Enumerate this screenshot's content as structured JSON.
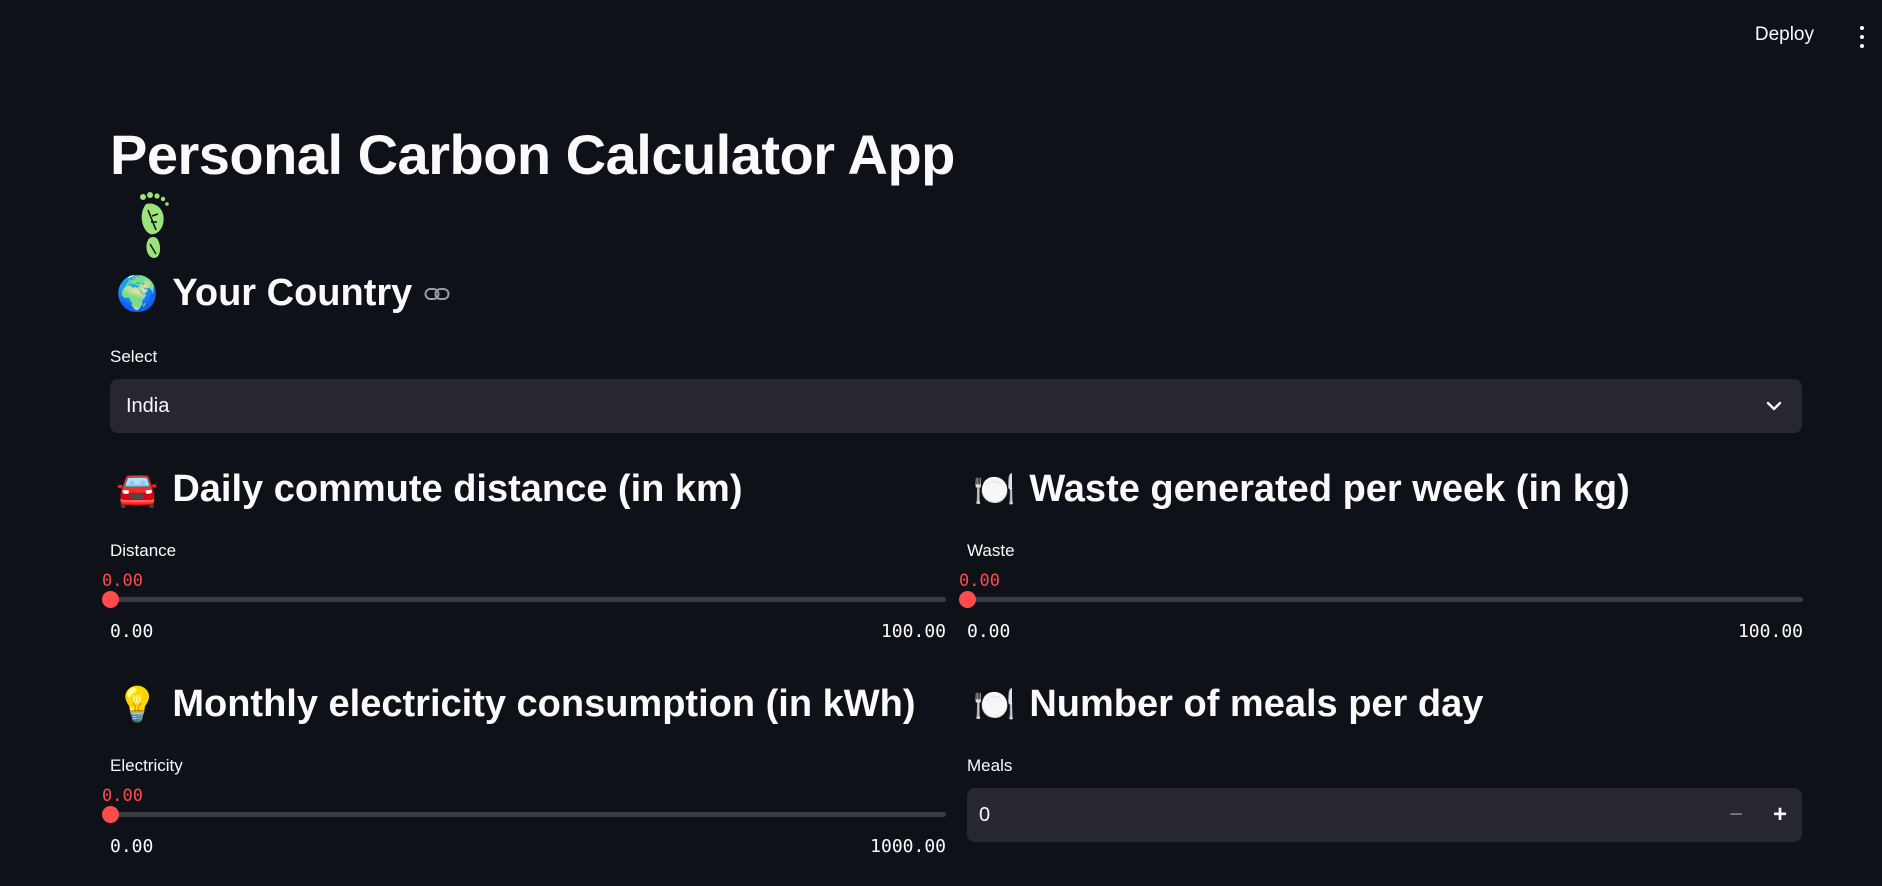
{
  "header": {
    "deploy_label": "Deploy",
    "menu_icon": "vertical-ellipsis-icon"
  },
  "page": {
    "title": "Personal Carbon Calculator App",
    "title_icon": "green-footprint-icon"
  },
  "country": {
    "heading": "Your Country",
    "heading_icon": "🌍",
    "link_icon": "link-icon",
    "select_label": "Select",
    "selected_value": "India"
  },
  "commute": {
    "heading": "Daily commute distance (in km)",
    "heading_icon": "🚘",
    "slider_label": "Distance",
    "value_text": "0.00",
    "min_text": "0.00",
    "max_text": "100.00",
    "value": 0,
    "min": 0,
    "max": 100
  },
  "waste": {
    "heading": "Waste generated per week (in kg)",
    "heading_icon": "🍽️",
    "slider_label": "Waste",
    "value_text": "0.00",
    "min_text": "0.00",
    "max_text": "100.00",
    "value": 0,
    "min": 0,
    "max": 100
  },
  "electricity": {
    "heading": "Monthly electricity consumption (in kWh)",
    "heading_icon": "💡",
    "slider_label": "Electricity",
    "value_text": "0.00",
    "min_text": "0.00",
    "max_text": "1000.00",
    "value": 0,
    "min": 0,
    "max": 1000
  },
  "meals": {
    "heading": "Number of meals per day",
    "heading_icon": "🍽️",
    "input_label": "Meals",
    "value": "0",
    "decrement_label": "−",
    "increment_label": "+"
  },
  "colors": {
    "background": "#0e1117",
    "widget_bg": "#262730",
    "accent": "#ff4b4b",
    "text": "#fafafa"
  }
}
